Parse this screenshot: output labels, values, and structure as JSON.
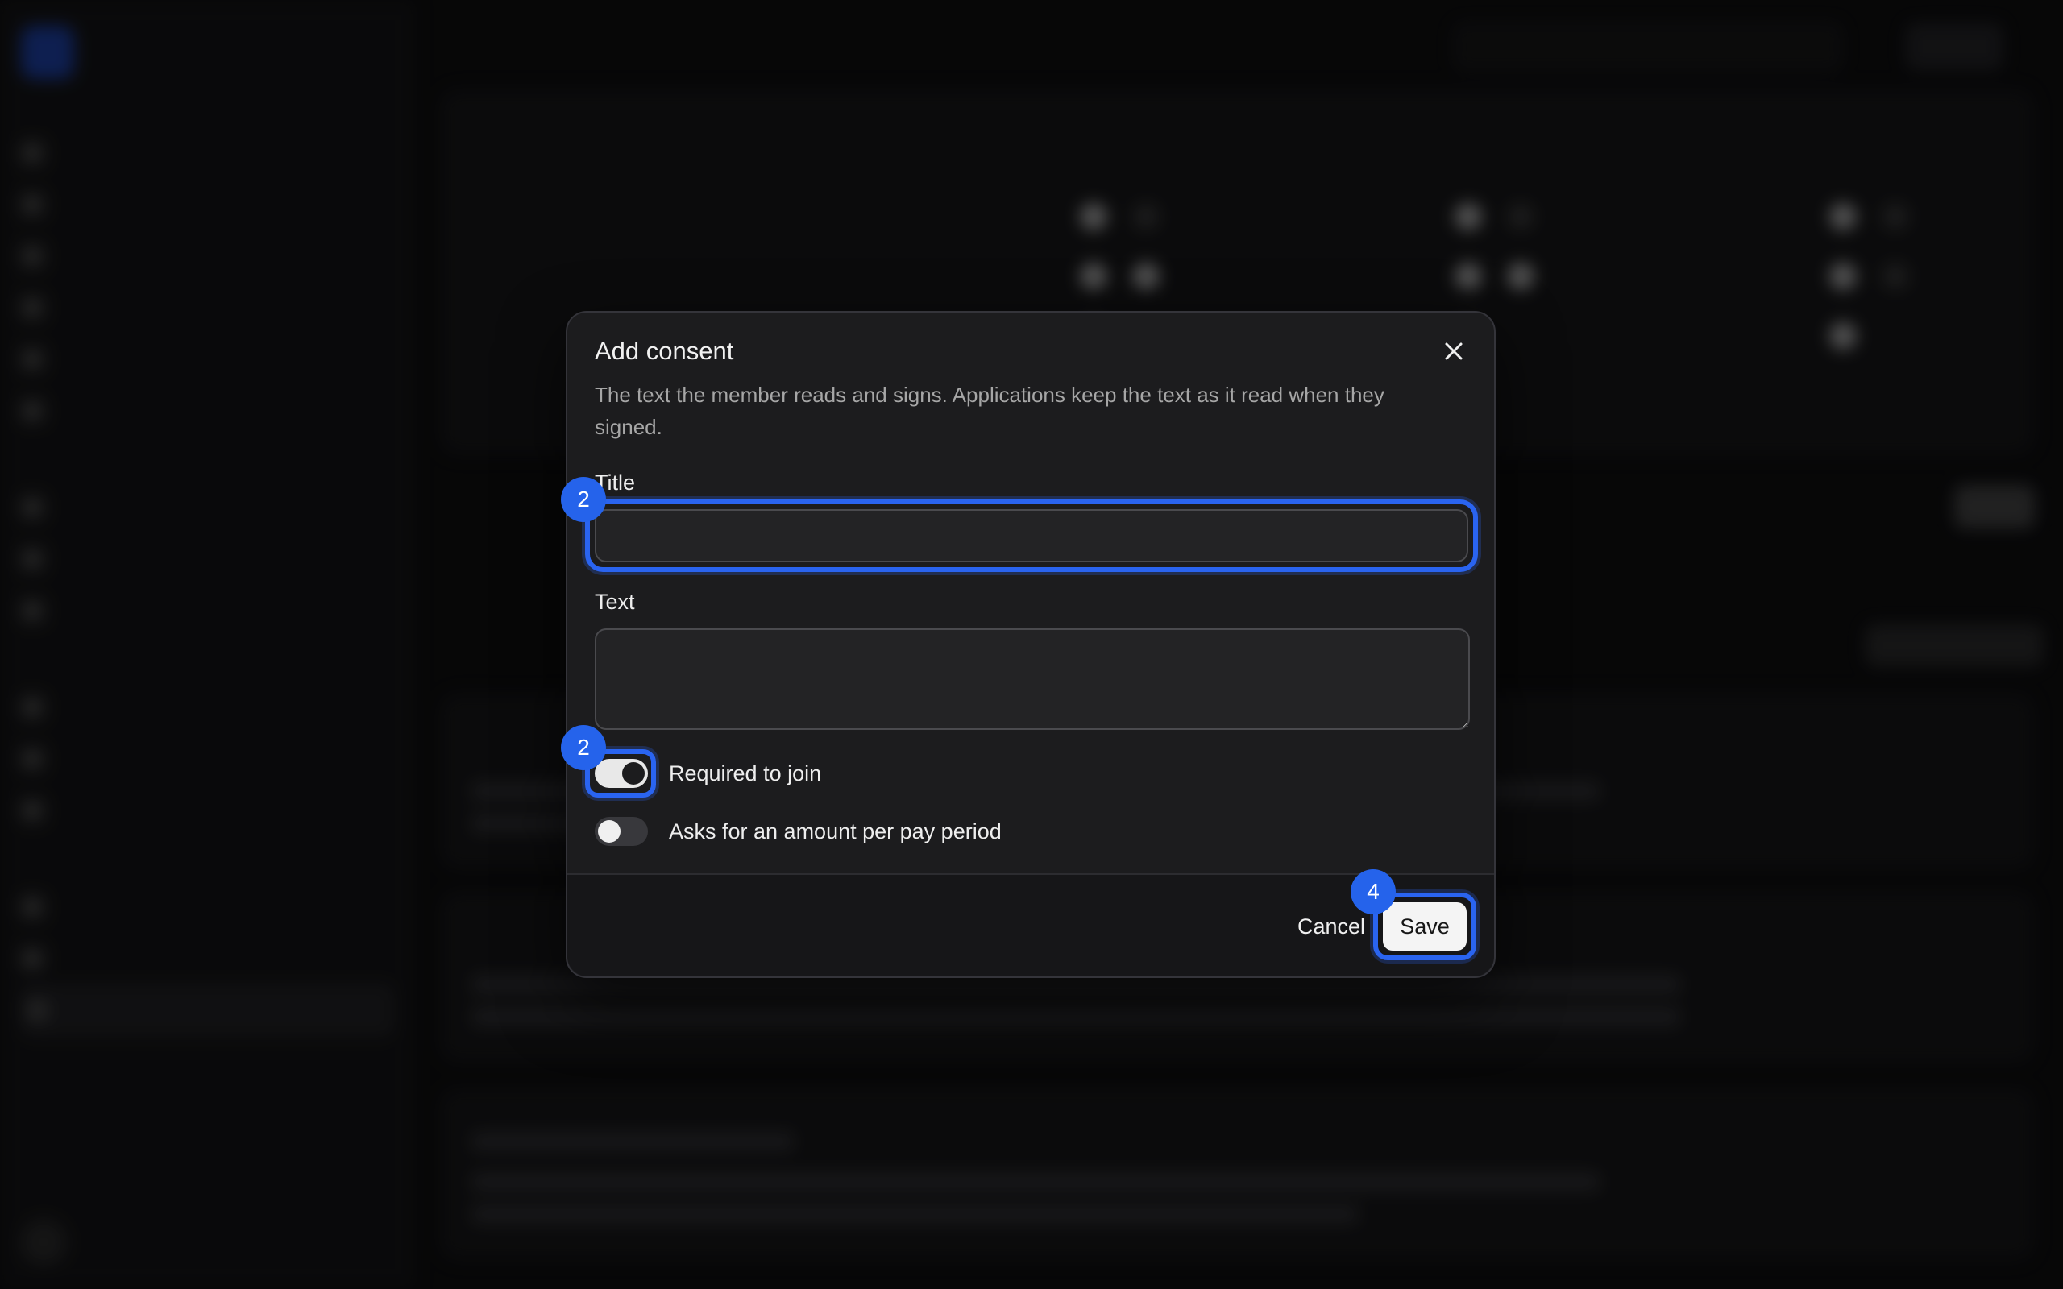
{
  "modal": {
    "title": "Add consent",
    "description": "The text the member reads and signs. Applications keep the text as it read when they signed.",
    "title_field": {
      "label": "Title",
      "value": "",
      "placeholder": ""
    },
    "text_field": {
      "label": "Text",
      "value": "",
      "placeholder": ""
    },
    "toggles": [
      {
        "label": "Required to join",
        "on": true
      },
      {
        "label": "Asks for an amount per pay period",
        "on": false
      }
    ],
    "cancel_label": "Cancel",
    "save_label": "Save"
  },
  "annotations": {
    "title_badge": "2",
    "toggle_badge": "2",
    "save_badge": "4"
  },
  "colors": {
    "accent": "#2563eb",
    "modal_bg": "#1c1c1e",
    "page_bg": "#0b0b0c"
  },
  "icons": {
    "close": "close-icon"
  }
}
